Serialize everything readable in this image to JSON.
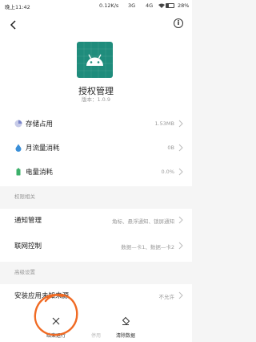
{
  "status_bar": {
    "time": "晚上11:42",
    "network_speed": "0.12K/s",
    "signal_1": "3G",
    "signal_2": "4G",
    "battery": "28%",
    "battery_level": 0.28
  },
  "app": {
    "name": "授权管理",
    "version": "版本：1.0.9"
  },
  "rows": {
    "storage": {
      "label": "存储占用",
      "value": "1.53MB"
    },
    "monthly_data": {
      "label": "月流量消耗",
      "value": "0B"
    },
    "battery": {
      "label": "电量消耗",
      "value": "0.0%"
    }
  },
  "permissions_section": {
    "title": "权限相关",
    "notification": {
      "label": "通知管理",
      "value": "角标、悬浮通知、锁屏通知"
    },
    "network": {
      "label": "联网控制",
      "value": "数据—卡1、数据—卡2"
    }
  },
  "advanced_section": {
    "title": "高级设置",
    "install_unknown": {
      "label": "安装应用未知来源",
      "value": "不允许"
    }
  },
  "bottom_bar": {
    "force_stop": "结束运行",
    "disable": "停用",
    "clear_data": "清除数据"
  },
  "colors": {
    "app_icon_bg": "#1f8c7c",
    "storage_icon": "#7b86c9",
    "data_icon": "#3a8fd8",
    "battery_icon": "#3bb06a",
    "annotation": "#f06a23"
  }
}
